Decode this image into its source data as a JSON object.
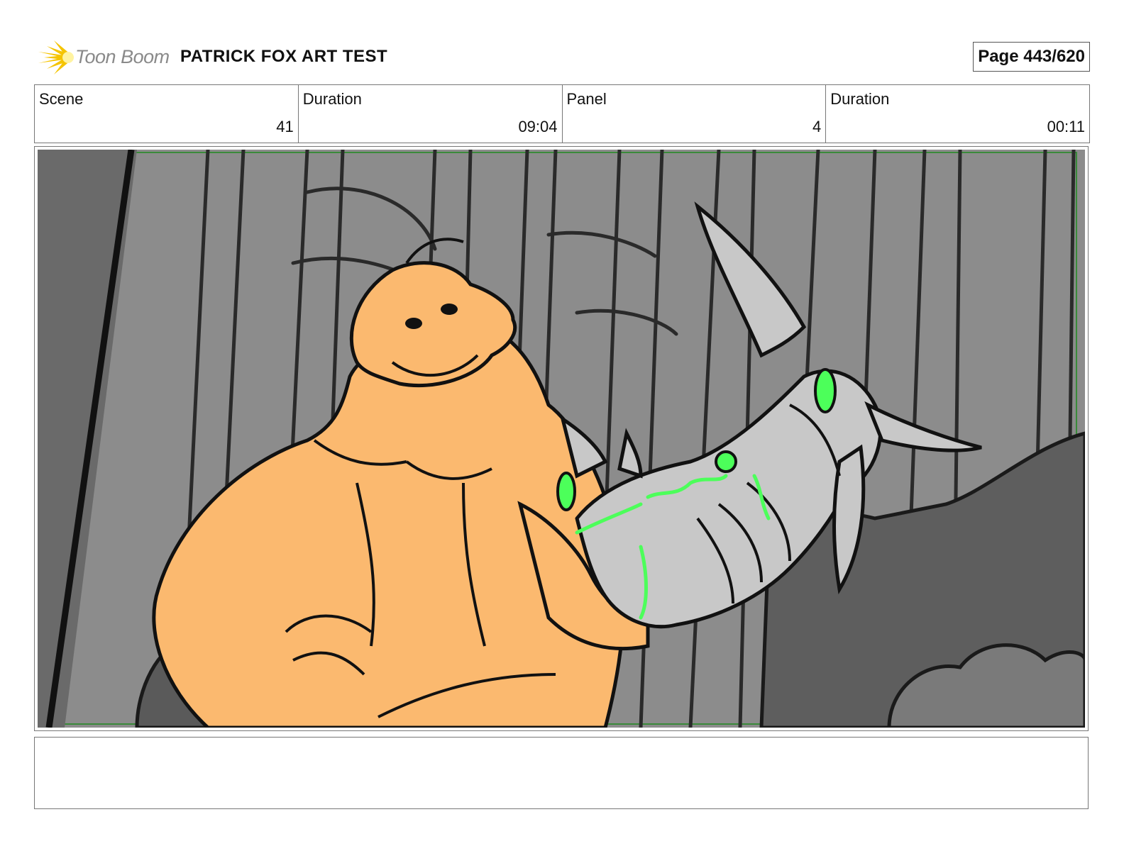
{
  "header": {
    "logo_text": "Toon Boom",
    "logo_icon": "starburst-logo-icon",
    "project_title": "PATRICK FOX ART TEST",
    "page_label": "Page 443/620"
  },
  "info": [
    {
      "label": "Scene",
      "value": "41"
    },
    {
      "label": "Duration",
      "value": "09:04"
    },
    {
      "label": "Panel",
      "value": "4"
    },
    {
      "label": "Duration",
      "value": "00:11"
    }
  ],
  "notes": "",
  "colors": {
    "logo_yellow": "#f5c400",
    "logo_gray": "#8a8a8a",
    "panel_border_green": "#3a8a3a",
    "character_orange": "#fbb96f",
    "robot_gray": "#c8c8c8",
    "robot_glow": "#4cff5a",
    "background_gray": "#8c8c8c"
  }
}
